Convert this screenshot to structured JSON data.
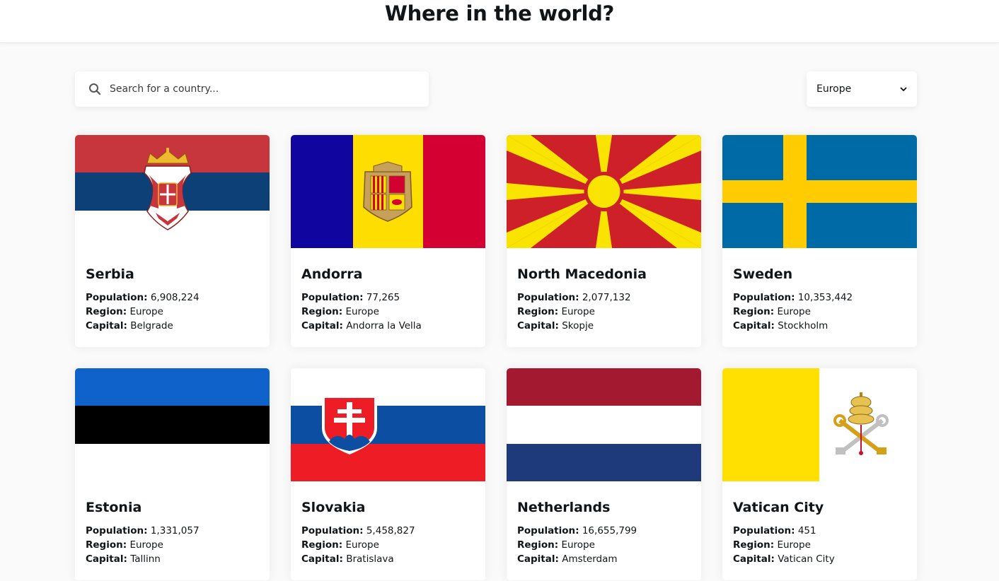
{
  "header": {
    "title": "Where in the world?"
  },
  "search": {
    "placeholder": "Search for a country..."
  },
  "filter": {
    "selected": "Europe"
  },
  "labels": {
    "population": "Population:",
    "region": "Region:",
    "capital": "Capital:"
  },
  "countries": [
    {
      "name": "Serbia",
      "population": "6,908,224",
      "region": "Europe",
      "capital": "Belgrade",
      "flag": "serbia-flag"
    },
    {
      "name": "Andorra",
      "population": "77,265",
      "region": "Europe",
      "capital": "Andorra la Vella",
      "flag": "andorra-flag"
    },
    {
      "name": "North Macedonia",
      "population": "2,077,132",
      "region": "Europe",
      "capital": "Skopje",
      "flag": "north-macedonia-flag"
    },
    {
      "name": "Sweden",
      "population": "10,353,442",
      "region": "Europe",
      "capital": "Stockholm",
      "flag": "sweden-flag"
    },
    {
      "name": "Estonia",
      "population": "1,331,057",
      "region": "Europe",
      "capital": "Tallinn",
      "flag": "estonia-flag"
    },
    {
      "name": "Slovakia",
      "population": "5,458,827",
      "region": "Europe",
      "capital": "Bratislava",
      "flag": "slovakia-flag"
    },
    {
      "name": "Netherlands",
      "population": "16,655,799",
      "region": "Europe",
      "capital": "Amsterdam",
      "flag": "netherlands-flag"
    },
    {
      "name": "Vatican City",
      "population": "451",
      "region": "Europe",
      "capital": "Vatican City",
      "flag": "vatican-city-flag"
    }
  ]
}
